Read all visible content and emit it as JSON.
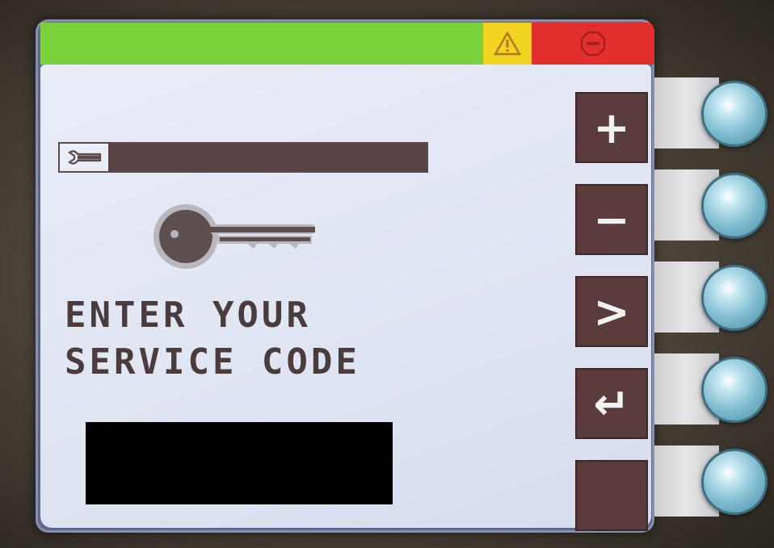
{
  "colors": {
    "status_ok": "#7bd13c",
    "status_warning": "#f2d322",
    "status_fault": "#e4302c",
    "screen_bg": "#e9edf7",
    "softkey_bg": "#5a3c3c",
    "text": "#4a3c3c"
  },
  "status_bar": {
    "warning_icon": "warning-triangle-icon",
    "fault_icon": "stop-sign-icon"
  },
  "progress": {
    "icon": "wrench-icon",
    "fill_fraction": 1.0
  },
  "key_icon": "key-icon",
  "prompt": {
    "line1": "ENTER YOUR",
    "line2": "SERVICE CODE"
  },
  "code_input": {
    "value": ""
  },
  "softkeys": [
    {
      "label": "+",
      "name": "plus-button"
    },
    {
      "label": "−",
      "name": "minus-button"
    },
    {
      "label": ">",
      "name": "next-button"
    },
    {
      "label": "↵",
      "name": "enter-button"
    },
    {
      "label": "",
      "name": "blank-softkey"
    }
  ]
}
